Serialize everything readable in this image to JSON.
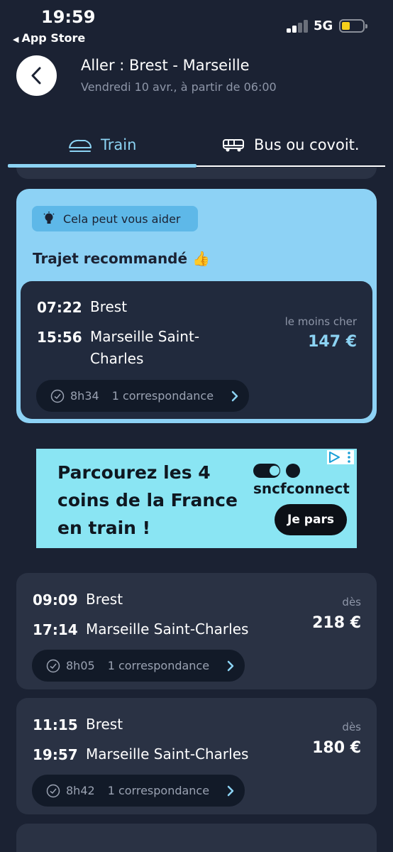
{
  "status_bar": {
    "time": "19:59",
    "back_app": "App Store",
    "network": "5G"
  },
  "header": {
    "title": "Aller : Brest - Marseille",
    "subtitle": "Vendredi 10 avr., à partir de 06:00"
  },
  "tabs": [
    {
      "label": "Train",
      "active": true
    },
    {
      "label": "Bus ou covoit.",
      "active": false
    }
  ],
  "recommendation": {
    "help_label": "Cela peut vous aider",
    "title": "Trajet recommandé",
    "emoji": "👍",
    "departure_time": "07:22",
    "departure_station": "Brest",
    "arrival_time": "15:56",
    "arrival_station": "Marseille Saint-Charles",
    "price_label": "le moins cher",
    "price": "147 €",
    "duration": "8h34",
    "connections": "1 correspondance"
  },
  "ad": {
    "headline": "Parcourez les 4 coins de la France en train !",
    "brand": "sncfconnect",
    "cta": "Je pars"
  },
  "results": [
    {
      "departure_time": "09:09",
      "departure_station": "Brest",
      "arrival_time": "17:14",
      "arrival_station": "Marseille Saint-Charles",
      "price_label": "dès",
      "price": "218 €",
      "duration": "8h05",
      "connections": "1 correspondance"
    },
    {
      "departure_time": "11:15",
      "departure_station": "Brest",
      "arrival_time": "19:57",
      "arrival_station": "Marseille Saint-Charles",
      "price_label": "dès",
      "price": "180 €",
      "duration": "8h42",
      "connections": "1 correspondance"
    }
  ],
  "colors": {
    "background": "#1b2233",
    "accent": "#8cd3f3",
    "card": "#2a3244",
    "ad_bg": "#8ae5f3"
  },
  "icons": [
    "train-icon",
    "bus-icon",
    "lightbulb-icon",
    "clock-icon",
    "chevron-right-icon",
    "back-arrow-icon"
  ]
}
